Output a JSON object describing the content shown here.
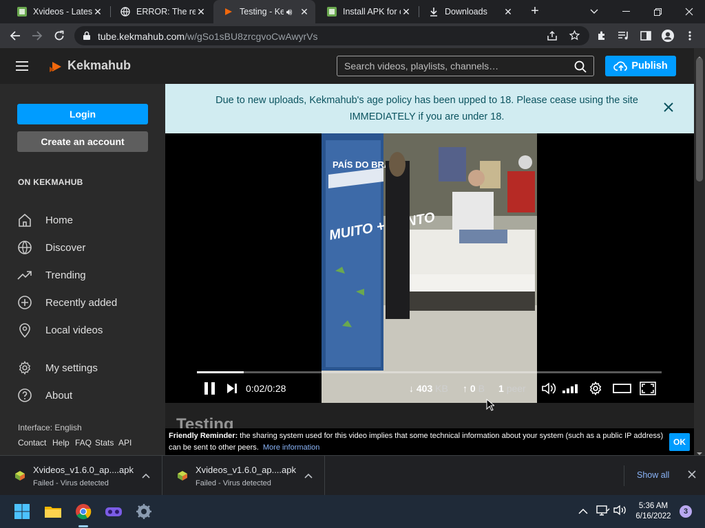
{
  "browser": {
    "tabs": [
      {
        "title": "Xvideos - Latest",
        "favicon": "green-app-icon",
        "active": false
      },
      {
        "title": "ERROR: The req",
        "favicon": "globe-icon",
        "active": false
      },
      {
        "title": "Testing - Ke",
        "favicon": "kekmahub-logo-icon",
        "active": true
      },
      {
        "title": "Install APK for c",
        "favicon": "green-app-icon",
        "active": false
      },
      {
        "title": "Downloads",
        "favicon": "download-icon",
        "active": false
      }
    ],
    "url_host": "tube.kekmahub.com",
    "url_path": "/w/gSo1sBU8zrcgvoCwAwyrVs"
  },
  "site": {
    "name": "Kekmahub",
    "search_placeholder": "Search videos, playlists, channels…",
    "publish_label": "Publish",
    "accent_color": "#009cff",
    "logo_color": "#f1680d"
  },
  "sidebar": {
    "login_label": "Login",
    "create_account_label": "Create an account",
    "section_heading": "ON KEKMAHUB",
    "items": [
      {
        "label": "Home",
        "icon": "home-icon"
      },
      {
        "label": "Discover",
        "icon": "globe-icon"
      },
      {
        "label": "Trending",
        "icon": "trending-icon"
      },
      {
        "label": "Recently added",
        "icon": "plus-circle-icon"
      },
      {
        "label": "Local videos",
        "icon": "location-icon"
      },
      {
        "label": "My settings",
        "icon": "gear-icon"
      },
      {
        "label": "About",
        "icon": "help-icon"
      }
    ],
    "interface_text": "Interface: English",
    "footer_links": [
      "Contact",
      "Help",
      "FAQ",
      "Stats",
      "API"
    ]
  },
  "banner": {
    "line1": "Due to new uploads, Kekmahub's age policy has been upped to 18. Please cease using the site",
    "line2": "IMMEDIATELY if you are under 18."
  },
  "player": {
    "time_current": "0:02",
    "time_total": "0:28",
    "downloaded": "403",
    "downloaded_unit": "KB",
    "uploaded": "0",
    "uploaded_unit": "B",
    "peers": "1",
    "peers_label": "peer",
    "progress_fraction": 0.1,
    "video_overlay_text": "MUITO + VENTO",
    "video_brand_text": "PAÍS DO BRASIL"
  },
  "video_title_partial": "Testing",
  "reminder": {
    "bold": "Friendly Reminder:",
    "text": " the sharing system used for this video implies that some technical information about your system (such as a public IP address) can be sent to other peers.",
    "link": "More information",
    "ok": "OK"
  },
  "downloads": {
    "items": [
      {
        "name": "Xvideos_v1.6.0_ap....apk",
        "status": "Failed - Virus detected"
      },
      {
        "name": "Xvideos_v1.6.0_ap....apk",
        "status": "Failed - Virus detected"
      }
    ],
    "show_all": "Show all"
  },
  "taskbar": {
    "time": "5:36 AM",
    "date": "6/16/2022",
    "notification_count": "3"
  }
}
